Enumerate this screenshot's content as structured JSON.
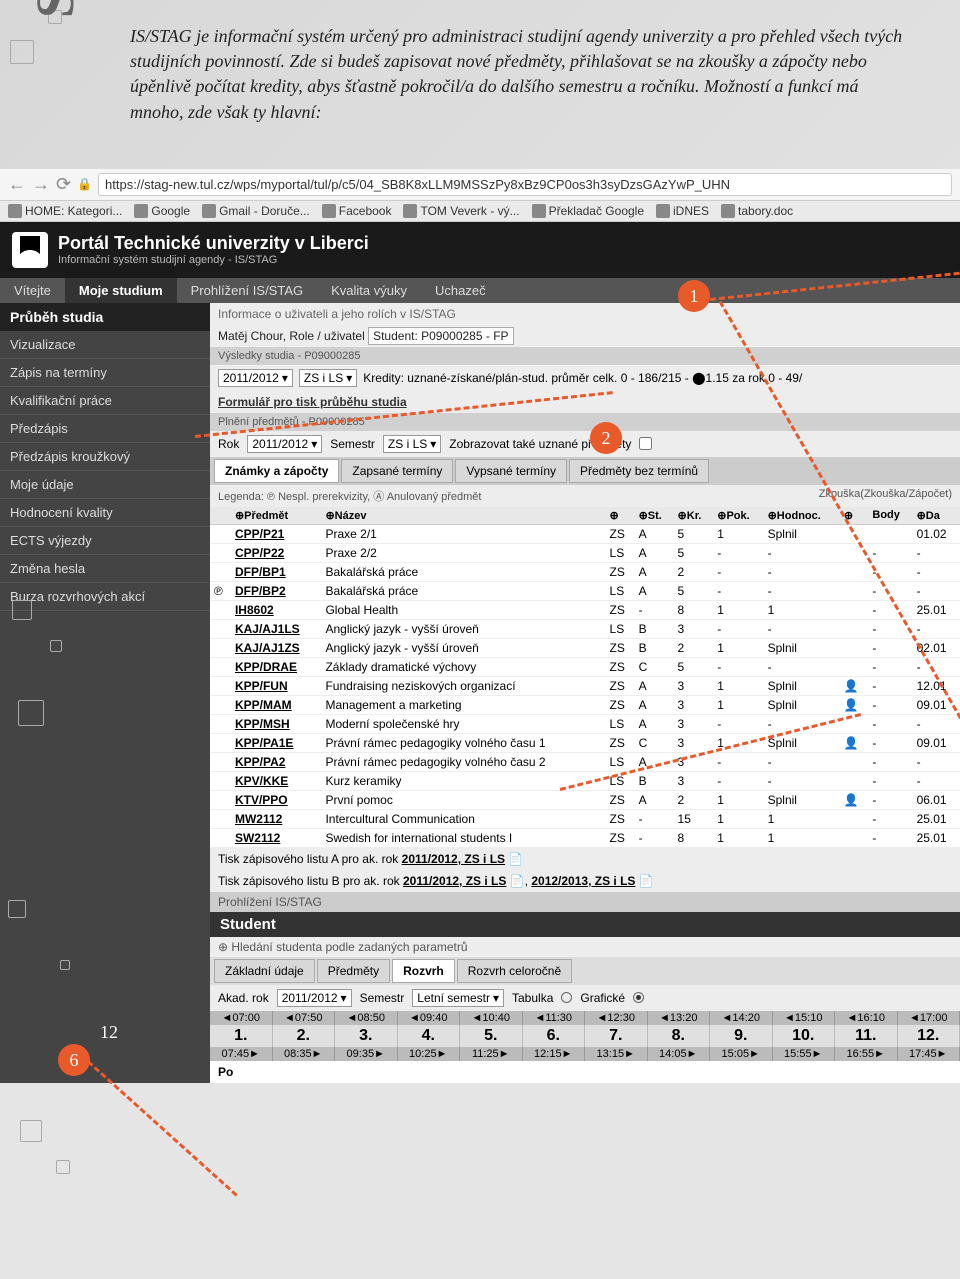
{
  "page": {
    "stag_label": "STAG",
    "page_number": "12"
  },
  "intro": "IS/STAG je informační systém určený pro administraci studijní agendy univerzity a pro přehled všech tvých studijních povinností. Zde si budeš zapisovat nové předměty, přihlašovat se na zkoušky a zápočty nebo úpěnlivě počítat kredity, abys šťastně pokročil/a do dalšího semestru a ročníku. Možností a funkcí má mnoho, zde však ty hlavní:",
  "badges": {
    "b1": "1",
    "b2": "2",
    "b6": "6"
  },
  "browser": {
    "url": "https://stag-new.tul.cz/wps/myportal/tul/p/c5/04_SB8K8xLLM9MSSzPy8xBz9CP0os3h3syDzsGAzYwP_UHN",
    "bookmarks": [
      "HOME: Kategori...",
      "Google",
      "Gmail - Doruče...",
      "Facebook",
      "TOM Veverk - vý...",
      "Překladač Google",
      "iDNES",
      "tabory.doc"
    ]
  },
  "portal": {
    "title": "Portál Technické univerzity v Liberci",
    "subtitle": "Informační systém studijní agendy - IS/STAG"
  },
  "topnav": [
    "Vítejte",
    "Moje studium",
    "Prohlížení IS/STAG",
    "Kvalita výuky",
    "Uchazeč"
  ],
  "topnav_active": 1,
  "sidebar": {
    "header": "Průběh studia",
    "items": [
      "Vizualizace",
      "Zápis na termíny",
      "Kvalifikační práce",
      "Předzápis",
      "Předzápis kroužkový",
      "Moje údaje",
      "Hodnocení kvality",
      "ECTS výjezdy",
      "Změna hesla",
      "Burza rozvrhových akcí"
    ]
  },
  "content": {
    "info_line": "Informace o uživateli a jeho rolích v IS/STAG",
    "user_line_prefix": "Matěj Chour, Role / uživatel",
    "user_role": "Student: P09000285 - FP",
    "vysledky": "Výsledky studia - P09000285",
    "year_sel": "2011/2012",
    "sem_sel": "ZS i LS",
    "kredity": "Kredity: uznané-získané/plán-stud. průměr  celk. 0 - 186/215 - ⬤1.15 za rok 0 - 49/",
    "formular": "Formulář pro tisk průběhu studia",
    "plneni": "Plnění předmětů - P09000285",
    "rok_label": "Rok",
    "sem_label": "Semestr",
    "zobraz": "Zobrazovat také uznané předměty",
    "tabs": [
      "Známky a zápočty",
      "Zapsané termíny",
      "Vypsané termíny",
      "Předměty bez termínů"
    ],
    "tab_active": 0,
    "legend_left": "Legenda: ℗ Nespl. prerekvizity, Ⓐ Anulovaný předmět",
    "legend_right": "Zkouška(Zkouška/Zápočet)",
    "table_headers": [
      "",
      "⊕Předmět",
      "⊕Název",
      "⊕",
      "⊕St.",
      "⊕Kr.",
      "⊕Pok.",
      "⊕Hodnoc.",
      "⊕",
      "Body",
      "⊕Da"
    ],
    "rows": [
      {
        "code": "CPP/P21",
        "name": "Praxe 2/1",
        "sem": "ZS",
        "st": "A",
        "kr": "5",
        "pok": "1",
        "hod": "Splnil",
        "ic": "",
        "body": "",
        "dat": "01.02"
      },
      {
        "code": "CPP/P22",
        "name": "Praxe 2/2",
        "sem": "LS",
        "st": "A",
        "kr": "5",
        "pok": "-",
        "hod": "-",
        "ic": "",
        "body": "-",
        "dat": "-"
      },
      {
        "code": "DFP/BP1",
        "name": "Bakalářská práce",
        "sem": "ZS",
        "st": "A",
        "kr": "2",
        "pok": "-",
        "hod": "-",
        "ic": "",
        "body": "-",
        "dat": "-"
      },
      {
        "code": "DFP/BP2",
        "name": "Bakalářská práce",
        "sem": "LS",
        "st": "A",
        "kr": "5",
        "pok": "-",
        "hod": "-",
        "ic": "",
        "body": "-",
        "dat": "-"
      },
      {
        "code": "IH8602",
        "name": "Global Health",
        "sem": "ZS",
        "st": "-",
        "kr": "8",
        "pok": "1",
        "hod": "1",
        "ic": "",
        "body": "-",
        "dat": "25.01"
      },
      {
        "code": "KAJ/AJ1LS",
        "name": "Anglický jazyk - vyšší úroveň",
        "sem": "LS",
        "st": "B",
        "kr": "3",
        "pok": "-",
        "hod": "-",
        "ic": "",
        "body": "-",
        "dat": "-"
      },
      {
        "code": "KAJ/AJ1ZS",
        "name": "Anglický jazyk - vyšší úroveň",
        "sem": "ZS",
        "st": "B",
        "kr": "2",
        "pok": "1",
        "hod": "Splnil",
        "ic": "",
        "body": "-",
        "dat": "02.01"
      },
      {
        "code": "KPP/DRAE",
        "name": "Základy dramatické výchovy",
        "sem": "ZS",
        "st": "C",
        "kr": "5",
        "pok": "-",
        "hod": "-",
        "ic": "",
        "body": "-",
        "dat": "-"
      },
      {
        "code": "KPP/FUN",
        "name": "Fundraising neziskových organizací",
        "sem": "ZS",
        "st": "A",
        "kr": "3",
        "pok": "1",
        "hod": "Splnil",
        "ic": "👤",
        "body": "-",
        "dat": "12.01"
      },
      {
        "code": "KPP/MAM",
        "name": "Management a marketing",
        "sem": "ZS",
        "st": "A",
        "kr": "3",
        "pok": "1",
        "hod": "Splnil",
        "ic": "👤",
        "body": "-",
        "dat": "09.01"
      },
      {
        "code": "KPP/MSH",
        "name": "Moderní společenské hry",
        "sem": "LS",
        "st": "A",
        "kr": "3",
        "pok": "-",
        "hod": "-",
        "ic": "",
        "body": "-",
        "dat": "-"
      },
      {
        "code": "KPP/PA1E",
        "name": "Právní rámec pedagogiky volného času 1",
        "sem": "ZS",
        "st": "C",
        "kr": "3",
        "pok": "1",
        "hod": "Splnil",
        "ic": "👤",
        "body": "-",
        "dat": "09.01"
      },
      {
        "code": "KPP/PA2",
        "name": "Právní rámec pedagogiky volného času 2",
        "sem": "LS",
        "st": "A",
        "kr": "3",
        "pok": "-",
        "hod": "-",
        "ic": "",
        "body": "-",
        "dat": "-"
      },
      {
        "code": "KPV/KKE",
        "name": "Kurz keramiky",
        "sem": "LS",
        "st": "B",
        "kr": "3",
        "pok": "-",
        "hod": "-",
        "ic": "",
        "body": "-",
        "dat": "-"
      },
      {
        "code": "KTV/PPO",
        "name": "První pomoc",
        "sem": "ZS",
        "st": "A",
        "kr": "2",
        "pok": "1",
        "hod": "Splnil",
        "ic": "👤",
        "body": "-",
        "dat": "06.01"
      },
      {
        "code": "MW2112",
        "name": "Intercultural Communication",
        "sem": "ZS",
        "st": "-",
        "kr": "15",
        "pok": "1",
        "hod": "1",
        "ic": "",
        "body": "-",
        "dat": "25.01"
      },
      {
        "code": "SW2112",
        "name": "Swedish for international students I",
        "sem": "ZS",
        "st": "-",
        "kr": "8",
        "pok": "1",
        "hod": "1",
        "ic": "",
        "body": "-",
        "dat": "25.01"
      }
    ],
    "tisk_a_label": "Tisk zápisového listu A pro ak. rok",
    "tisk_a_link": "2011/2012, ZS i LS",
    "tisk_b_label": "Tisk zápisového listu B pro ak. rok",
    "tisk_b_link1": "2011/2012, ZS i LS",
    "tisk_b_link2": "2012/2013, ZS i LS",
    "prohlizeni": "Prohlížení IS/STAG",
    "student_hdr": "Student",
    "student_sub": "Hledání studenta podle zadaných parametrů",
    "student_tabs": [
      "Základní údaje",
      "Předměty",
      "Rozvrh",
      "Rozvrh celoročně"
    ],
    "student_tab_active": 2,
    "akad_label": "Akad. rok",
    "akad_val": "2011/2012",
    "sem2_label": "Semestr",
    "sem2_val": "Letní semestr",
    "tabulka": "Tabulka",
    "graficke": "Grafické",
    "times_top": [
      "◄07:00",
      "◄07:50",
      "◄08:50",
      "◄09:40",
      "◄10:40",
      "◄11:30",
      "◄12:30",
      "◄13:20",
      "◄14:20",
      "◄15:10",
      "◄16:10",
      "◄17:00"
    ],
    "days": [
      {
        "n": "1.",
        "t": "07:45►"
      },
      {
        "n": "2.",
        "t": "08:35►"
      },
      {
        "n": "3.",
        "t": "09:35►"
      },
      {
        "n": "4.",
        "t": "10:25►"
      },
      {
        "n": "5.",
        "t": "11:25►"
      },
      {
        "n": "6.",
        "t": "12:15►"
      },
      {
        "n": "7.",
        "t": "13:15►"
      },
      {
        "n": "8.",
        "t": "14:05►"
      },
      {
        "n": "9.",
        "t": "15:05►"
      },
      {
        "n": "10.",
        "t": "15:55►"
      },
      {
        "n": "11.",
        "t": "16:55►"
      },
      {
        "n": "12.",
        "t": "17:45►"
      }
    ],
    "po": "Po"
  }
}
